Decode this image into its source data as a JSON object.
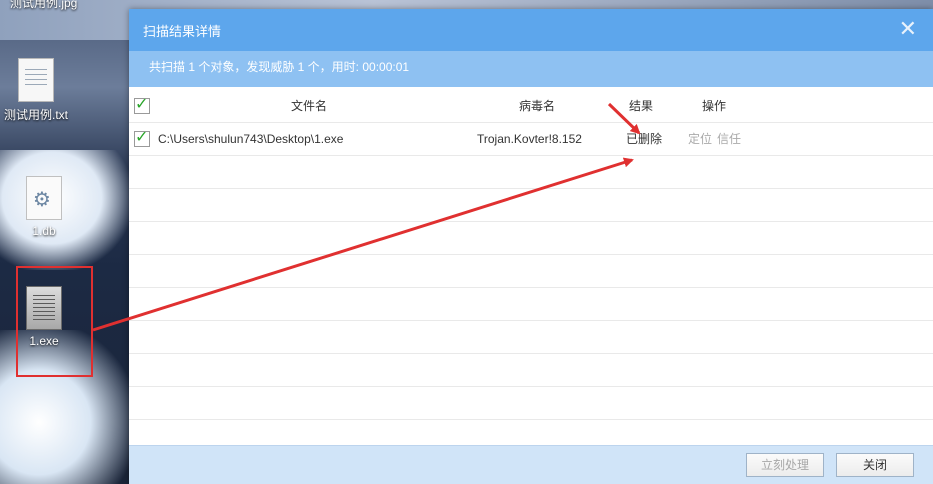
{
  "desktop": {
    "top_label": "测试用例.jpg",
    "icons": [
      {
        "label": "测试用例.txt",
        "type": "text-file-icon"
      },
      {
        "label": "1.db",
        "type": "settings-file-icon"
      },
      {
        "label": "1.exe",
        "type": "exe-file-icon"
      }
    ]
  },
  "dialog": {
    "title": "扫描结果详情",
    "close_symbol": "✕",
    "summary": "共扫描 1 个对象，发现威胁 1 个，用时: 00:00:01",
    "table": {
      "headers": {
        "filename": "文件名",
        "virus": "病毒名",
        "result": "结果",
        "action": "操作"
      },
      "rows": [
        {
          "path": "C:\\Users\\shulun743\\Desktop\\1.exe",
          "virus": "Trojan.Kovter!8.152",
          "result": "已删除",
          "action_locate": "定位",
          "action_trust": "信任"
        }
      ]
    },
    "buttons": {
      "process_now": "立刻处理",
      "close": "关闭"
    }
  },
  "colors": {
    "titlebar": "#5da6ec",
    "summary_bar": "#8ec1f2",
    "footer": "#d0e4f8",
    "annotation": "#e03030"
  }
}
